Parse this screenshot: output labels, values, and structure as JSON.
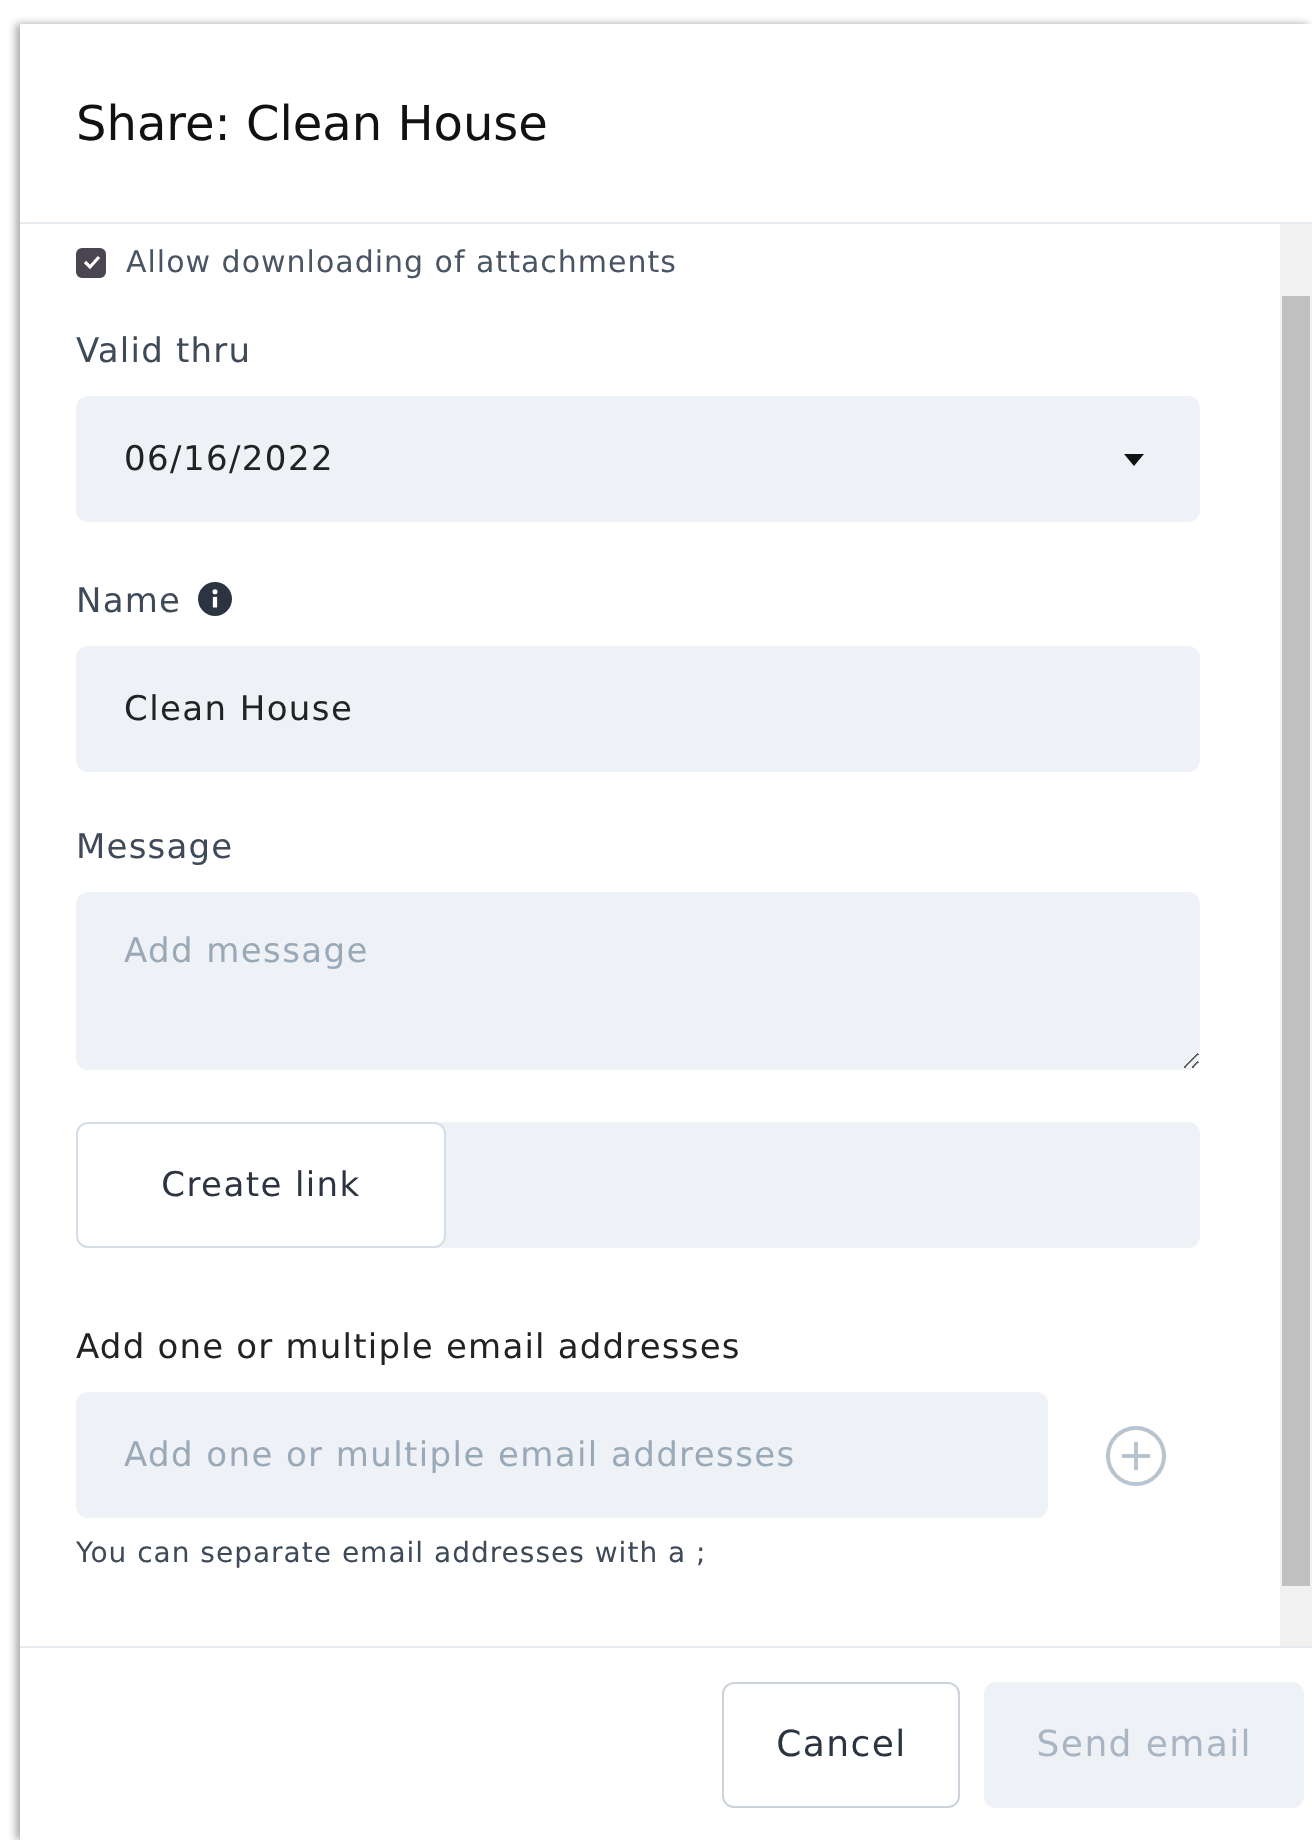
{
  "dialog": {
    "title": "Share: Clean House"
  },
  "allow_downloads": {
    "label": "Allow downloading of attachments",
    "checked": true
  },
  "valid_thru": {
    "label": "Valid thru",
    "value": "06/16/2022"
  },
  "name": {
    "label": "Name",
    "value": "Clean House"
  },
  "message": {
    "label": "Message",
    "placeholder": "Add message"
  },
  "create_link": {
    "label": "Create link"
  },
  "emails": {
    "label": "Add one or multiple email addresses",
    "placeholder": "Add one or multiple email addresses",
    "hint": "You can separate email addresses with a ;"
  },
  "buttons": [
    {
      "label": "Cancel",
      "disabled": false
    },
    {
      "label": "Send email",
      "disabled": true
    }
  ]
}
